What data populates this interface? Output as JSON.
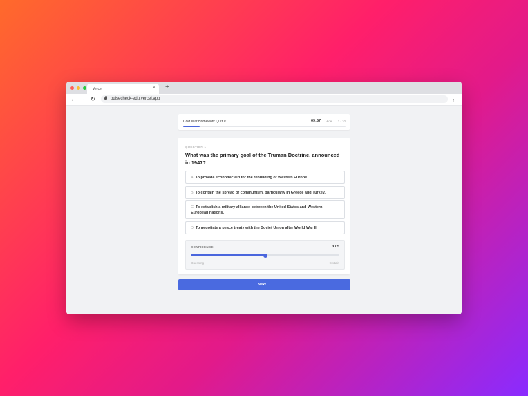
{
  "browser": {
    "tab_title": "Vercel",
    "tab_close": "×",
    "new_tab": "+",
    "url": "pulsecheck-edu.vercel.app",
    "back": "←",
    "forward": "→",
    "reload": "↻",
    "menu": "⋮"
  },
  "quiz": {
    "title": "Cold War Homework Quiz #1",
    "timer": "09:57",
    "hide_label": "Hide",
    "progress_text": "1 / 10",
    "progress_fraction": 0.1
  },
  "question": {
    "label": "QUESTION 1",
    "text": "What was the primary goal of the Truman Doctrine, announced in 1947?",
    "options": [
      {
        "letter": "A",
        "text": "To provide economic aid for the rebuilding of Western Europe."
      },
      {
        "letter": "B",
        "text": "To contain the spread of communism, particularly in Greece and Turkey."
      },
      {
        "letter": "C",
        "text": "To establish a military alliance between the United States and Western European nations."
      },
      {
        "letter": "D",
        "text": "To negotiate a peace treaty with the Soviet Union after World War II."
      }
    ]
  },
  "confidence": {
    "label": "CONFIDENCE",
    "value_text": "3 / 5",
    "value": 3,
    "max": 5,
    "min_label": "Guessing",
    "max_label": "Certain"
  },
  "next_label": "Next →",
  "colors": {
    "accent": "#4a66dd",
    "button": "#4a6ae0"
  }
}
